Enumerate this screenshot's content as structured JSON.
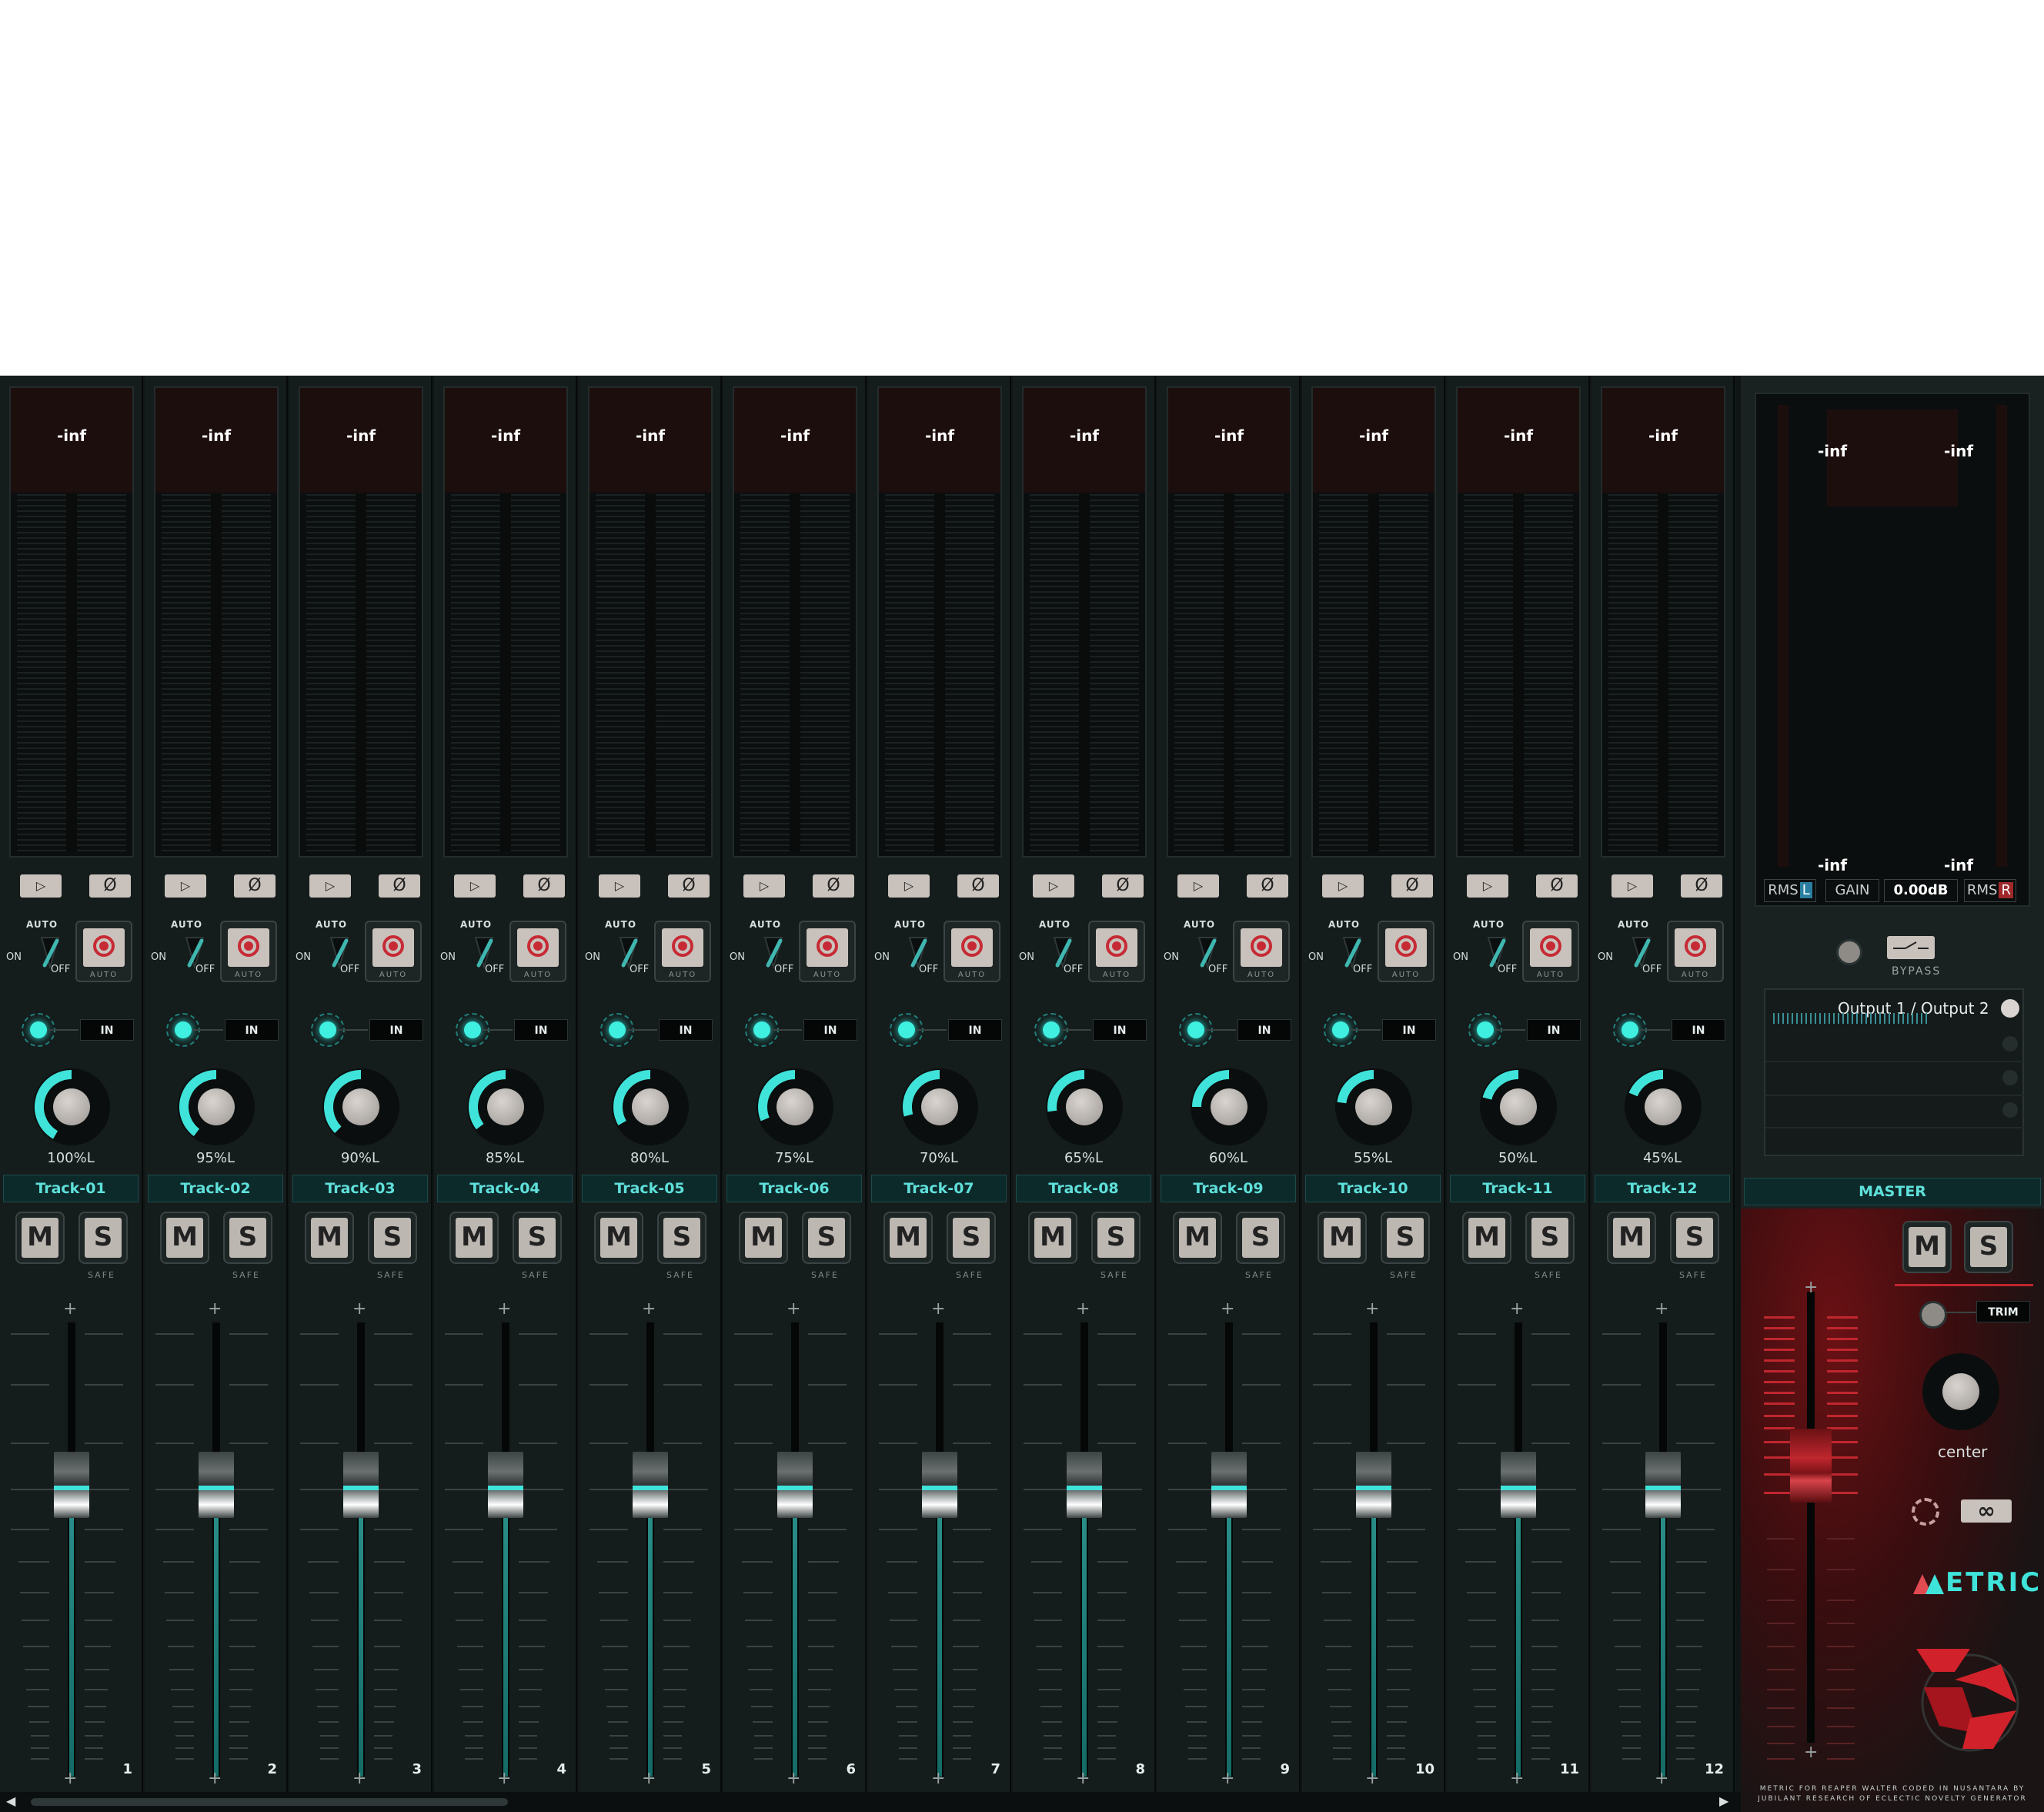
{
  "strips": [
    {
      "name": "Track-01",
      "number": "1",
      "peak": "-inf",
      "pan": "100%L",
      "pan_fraction": 1.0
    },
    {
      "name": "Track-02",
      "number": "2",
      "peak": "-inf",
      "pan": "95%L",
      "pan_fraction": 0.95
    },
    {
      "name": "Track-03",
      "number": "3",
      "peak": "-inf",
      "pan": "90%L",
      "pan_fraction": 0.9
    },
    {
      "name": "Track-04",
      "number": "4",
      "peak": "-inf",
      "pan": "85%L",
      "pan_fraction": 0.85
    },
    {
      "name": "Track-05",
      "number": "5",
      "peak": "-inf",
      "pan": "80%L",
      "pan_fraction": 0.8
    },
    {
      "name": "Track-06",
      "number": "6",
      "peak": "-inf",
      "pan": "75%L",
      "pan_fraction": 0.75
    },
    {
      "name": "Track-07",
      "number": "7",
      "peak": "-inf",
      "pan": "70%L",
      "pan_fraction": 0.7
    },
    {
      "name": "Track-08",
      "number": "8",
      "peak": "-inf",
      "pan": "65%L",
      "pan_fraction": 0.65
    },
    {
      "name": "Track-09",
      "number": "9",
      "peak": "-inf",
      "pan": "60%L",
      "pan_fraction": 0.6
    },
    {
      "name": "Track-10",
      "number": "10",
      "peak": "-inf",
      "pan": "55%L",
      "pan_fraction": 0.55
    },
    {
      "name": "Track-11",
      "number": "11",
      "peak": "-inf",
      "pan": "50%L",
      "pan_fraction": 0.5
    },
    {
      "name": "Track-12",
      "number": "12",
      "peak": "-inf",
      "pan": "45%L",
      "pan_fraction": 0.45
    }
  ],
  "labels": {
    "auto": "AUTO",
    "on": "ON",
    "off": "OFF",
    "rec_auto": "AUTO",
    "in": "IN",
    "mute": "M",
    "solo": "S",
    "safe": "SAFE",
    "phase": "Ø",
    "plus": "+"
  },
  "master": {
    "name": "MASTER",
    "peak_l_top": "-inf",
    "peak_r_top": "-inf",
    "peak_l_bottom": "-inf",
    "peak_r_bottom": "-inf",
    "rms_label": "RMS",
    "rms_l_channel": "L",
    "rms_r_channel": "R",
    "gain_label": "GAIN",
    "gain_value": "0.00dB",
    "bypass": "BYPASS",
    "routing": "Output 1 / Output 2",
    "trim": "TRIM",
    "pan": "center",
    "mute": "M",
    "solo": "S",
    "brand": "ETRIC",
    "credit": "METRIC FOR REAPER WALTER CODED IN NUSANTARA BY JUBILANT RESEARCH OF ECLECTIC NOVELTY GENERATOR"
  },
  "colors": {
    "accent": "#3fe3da",
    "record": "#c62b35",
    "master_red": "#c0262e",
    "background": "#101616"
  },
  "icons": [
    "speaker-icon",
    "phase-icon",
    "automation-toggle-icon",
    "record-arm-icon",
    "input-led-icon",
    "pan-knob-icon",
    "link-icon",
    "bypass-switch-icon",
    "trim-knob-icon",
    "stereo-link-icon",
    "scroll-left-icon",
    "scroll-right-icon"
  ]
}
